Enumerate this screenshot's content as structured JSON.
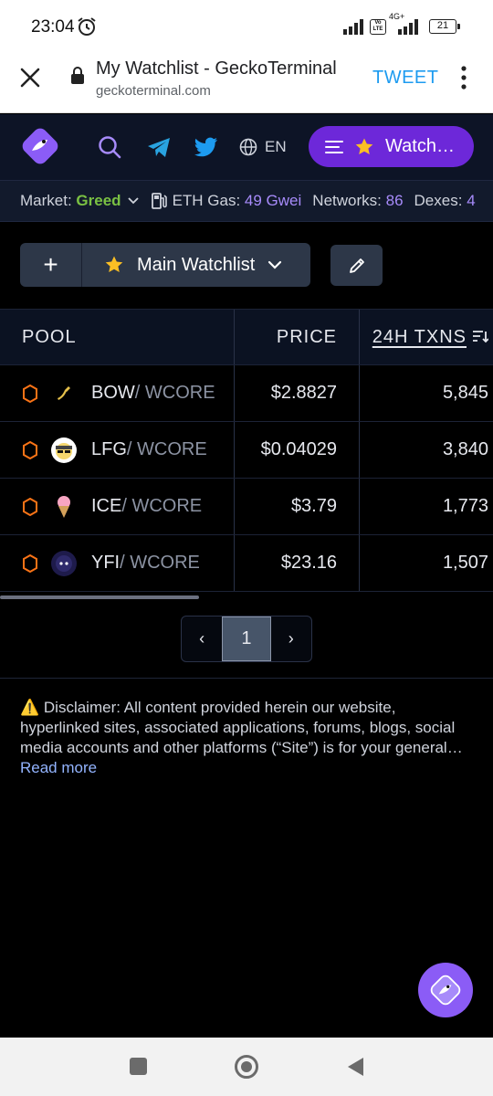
{
  "status_bar": {
    "time": "23:04",
    "network_type": "4G+",
    "volte": "Vo LTE",
    "battery": "21"
  },
  "browser": {
    "page_title": "My Watchlist - GeckoTerminal",
    "url": "geckoterminal.com",
    "action_label": "TWEET"
  },
  "header": {
    "language": "EN",
    "watchlist_button_label": "Watchlist"
  },
  "ticker": {
    "market_label": "Market:",
    "market_value": "Greed",
    "gas_label": "ETH Gas:",
    "gas_value": "49 Gwei",
    "networks_label": "Networks:",
    "networks_value": "86",
    "dexes_label": "Dexes:",
    "dexes_value": "4"
  },
  "watchlist": {
    "add_label": "+",
    "selected": "Main Watchlist"
  },
  "table": {
    "headers": {
      "pool": "POOL",
      "price": "PRICE",
      "txns": "24H TXNS"
    },
    "rows": [
      {
        "base": "BOW",
        "quote": " / WCORE",
        "price": "$2.8827",
        "txns": "5,845",
        "icon": "bow-token-icon",
        "icon_color": "#000000"
      },
      {
        "base": "LFG",
        "quote": " / WCORE",
        "price": "$0.04029",
        "txns": "3,840",
        "icon": "lfg-token-icon",
        "icon_color": "#ffffff"
      },
      {
        "base": "ICE",
        "quote": " / WCORE",
        "price": "$3.79",
        "txns": "1,773",
        "icon": "ice-cream-token-icon",
        "icon_color": "#000000"
      },
      {
        "base": "YFI",
        "quote": " / WCORE",
        "price": "$23.16",
        "txns": "1,507",
        "icon": "yfi-token-icon",
        "icon_color": "#1e1b4b"
      }
    ]
  },
  "pagination": {
    "prev": "‹",
    "current": "1",
    "next": "›"
  },
  "disclaimer": {
    "text": "⚠️ Disclaimer: All content provided herein our website, hyperlinked sites, associated applications, forums, blogs, social media accounts and other platforms (“Site”) is for your general…",
    "read_more": "Read more"
  },
  "colors": {
    "accent": "#6d28d9",
    "greed": "#7ac143",
    "gas": "#a78bfa",
    "chain_hex": "#f97316"
  }
}
